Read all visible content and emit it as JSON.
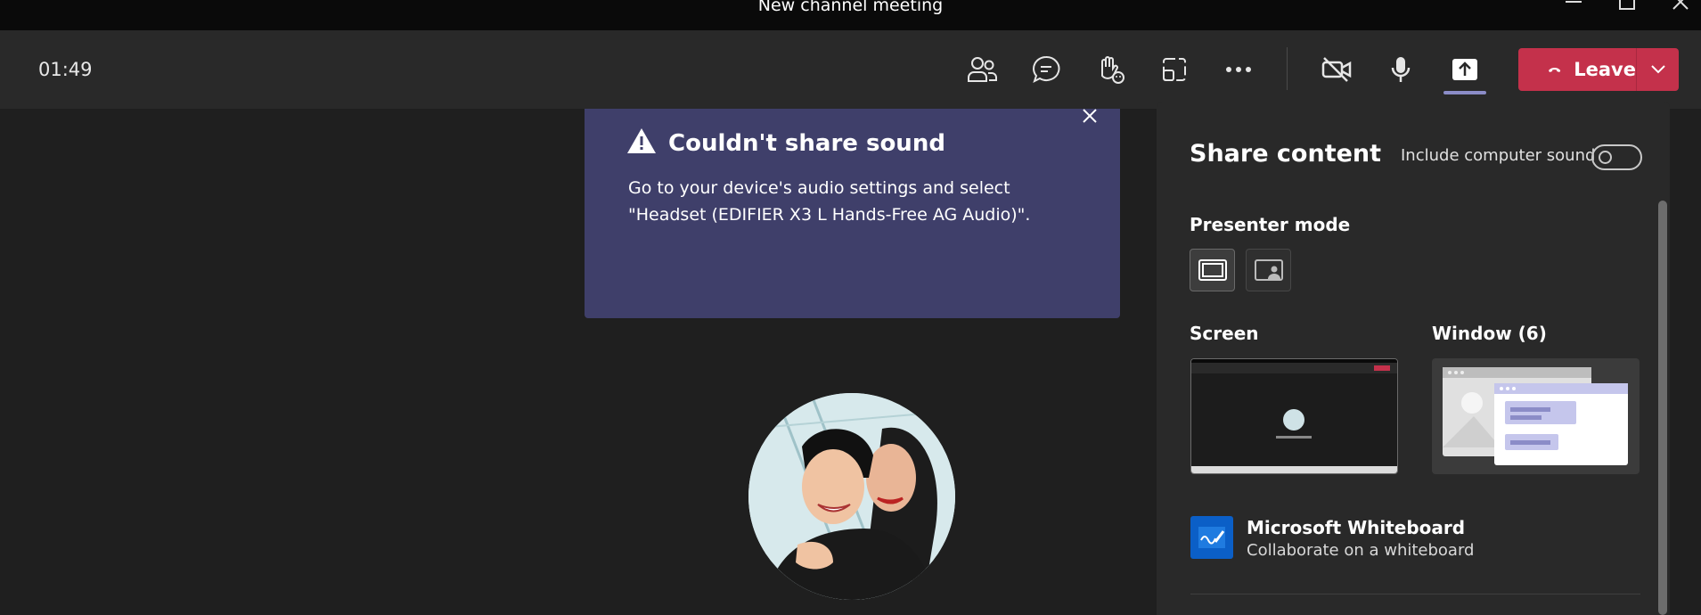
{
  "window": {
    "title": "New channel meeting"
  },
  "toolbar": {
    "timer": "01:49",
    "icons": [
      "people-icon",
      "chat-icon",
      "raise-hand-icon",
      "view-icon",
      "more-icon",
      "camera-off-icon",
      "mic-icon",
      "share-icon"
    ],
    "leave_label": "Leave"
  },
  "toast": {
    "title": "Couldn't share sound",
    "body": "Go to your device's audio settings and select \"Headset (EDIFIER X3 L Hands-Free AG Audio)\"."
  },
  "panel": {
    "title": "Share content",
    "sound_label": "Include computer sound",
    "sound_enabled": false,
    "presenter_mode_label": "Presenter mode",
    "screen_label": "Screen",
    "window_label": "Window (6)",
    "whiteboard_title": "Microsoft Whiteboard",
    "whiteboard_subtitle": "Collaborate on a whiteboard"
  },
  "colors": {
    "accent": "#8b8cc7",
    "leave": "#c4314b",
    "toast": "#3f3f6a",
    "whiteboard": "#0b5fc7"
  }
}
